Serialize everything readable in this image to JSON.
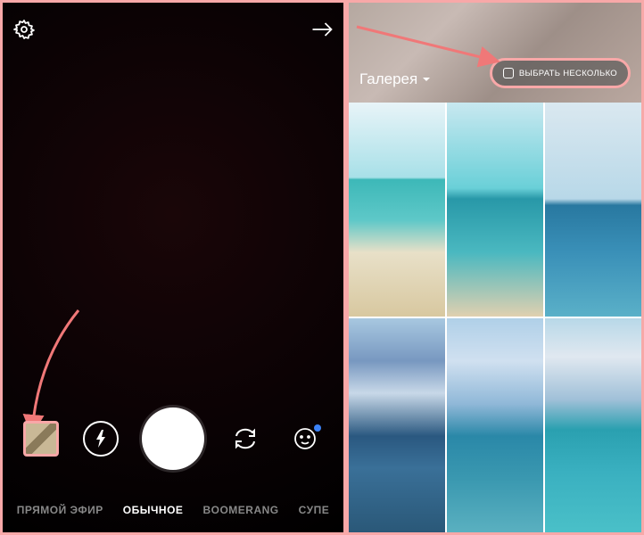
{
  "camera": {
    "modes": [
      "ПРЯМОЙ ЭФИР",
      "ОБЫЧНОЕ",
      "BOOMERANG",
      "СУПЕ"
    ],
    "active_mode_index": 1,
    "icons": {
      "settings": "gear-icon",
      "forward": "arrow-right-icon",
      "gallery_thumb": "gallery-thumb",
      "flash": "flash-icon",
      "shutter": "shutter-button",
      "switch": "camera-switch-icon",
      "face": "face-filter-icon"
    }
  },
  "gallery": {
    "title": "Галерея",
    "select_multi_label": "ВЫБРАТЬ НЕСКОЛЬКО",
    "thumbnails": [
      {
        "variant": "sky-a"
      },
      {
        "variant": "sky-b"
      },
      {
        "variant": "sky-c"
      },
      {
        "variant": "sky-d"
      },
      {
        "variant": "sky-e"
      },
      {
        "variant": "sky-f"
      }
    ]
  },
  "annotations": {
    "arrow_color": "#f07878"
  }
}
